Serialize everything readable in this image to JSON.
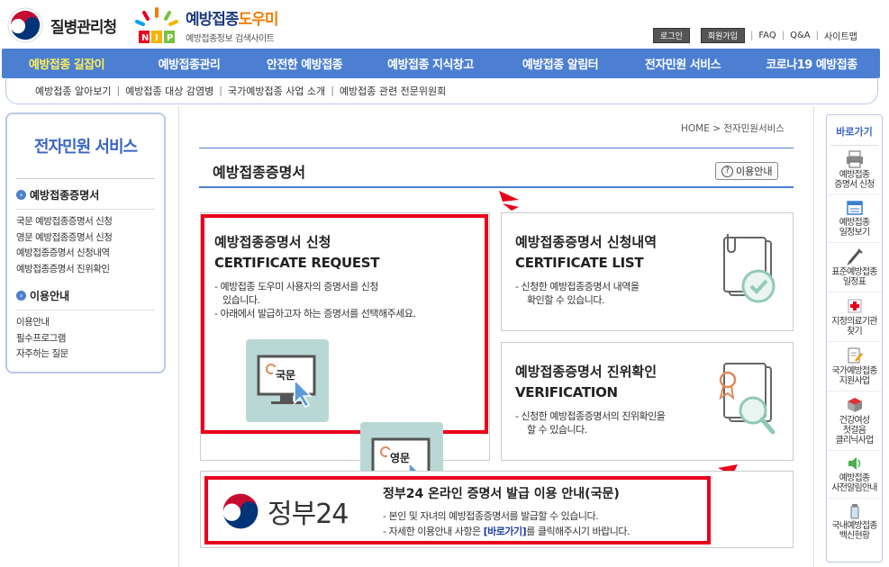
{
  "header": {
    "kdca_name": "질병관리청",
    "nip_title_main": "예방접종",
    "nip_title_accent": "도우미",
    "nip_subtitle": "예방접종정보 검색사이트",
    "nip_badge": "NIP",
    "util": {
      "login": "로그인",
      "join": "회원가입",
      "faq": "FAQ",
      "qna": "Q&A",
      "sitemap": "사이트맵"
    }
  },
  "gnb": [
    "예방접종 길잡이",
    "예방접종관리",
    "안전한 예방접종",
    "예방접종 지식창고",
    "예방접종 알림터",
    "전자민원 서비스",
    "코로나19 예방접종"
  ],
  "subnav": [
    "예방접종 알아보기",
    "예방접종 대상 감염병",
    "국가예방접종 사업 소개",
    "예방접종 관련 전문위원회"
  ],
  "lnb": {
    "title": "전자민원 서비스",
    "group1": "예방접종증명서",
    "group1_items": [
      "국문 예방접종증명서 신청",
      "영문 예방접종증명서 신청",
      "예방접종증명서 신청내역",
      "예방접종증명서 진위확인"
    ],
    "group2": "이용안내",
    "group2_items": [
      "이용안내",
      "필수프로그램",
      "자주하는 질문"
    ]
  },
  "breadcrumb": "HOME > 전자민원서비스",
  "page_title": "예방접종증명서",
  "usage_btn": "이용안내",
  "box_request": {
    "title_ko": "예방접종증명서 신청",
    "title_en": "CERTIFICATE REQUEST",
    "desc1": "- 예방접종 도우미 사용자의 증명서를 신청",
    "desc1b": "있습니다.",
    "desc2": "- 아래에서 발급하고자 하는 증명서를 선택해주세요.",
    "btn_ko": "국문",
    "btn_en": "영문"
  },
  "box_list": {
    "title_ko": "예방접종증명서 신청내역",
    "title_en": "CERTIFICATE LIST",
    "desc1": "- 신청한 예방접종증명서 내역을",
    "desc1b": "확인할 수 있습니다."
  },
  "box_verify": {
    "title_ko": "예방접종증명서 진위확인",
    "title_en": "VERIFICATION",
    "desc1": "- 신청한 예방접종증명서의 진위확인을",
    "desc1b": "할 수 있습니다."
  },
  "gov24": {
    "logo_text": "정부24",
    "title": "정부24 온라인 증명서 발급 이용 안내(국문)",
    "desc1": "- 본인 및 자녀의 예방접종증명서를 발급할 수 있습니다.",
    "desc2_pre": "- 자세한 이용안내 사항은 ",
    "desc2_link": "[바로가기]",
    "desc2_post": "를 클릭해주시기 바랍니다."
  },
  "quick": {
    "title": "바로가기",
    "items": [
      [
        "예방접종",
        "증명서 신청"
      ],
      [
        "예방접종",
        "일정보기"
      ],
      [
        "표준예방접종",
        "일정표"
      ],
      [
        "지정의료기관",
        "찾기"
      ],
      [
        "국가예방접종",
        "지원사업"
      ],
      [
        "건강여성",
        "첫걸음",
        "클리닉사업"
      ],
      [
        "예방접종",
        "사전알림안내"
      ],
      [
        "국내예방접종",
        "백신현황"
      ]
    ]
  },
  "colors": {
    "nav_blue": "#4c7fd1",
    "highlight_red": "#e8001c",
    "title_blue": "#3a66c3"
  }
}
